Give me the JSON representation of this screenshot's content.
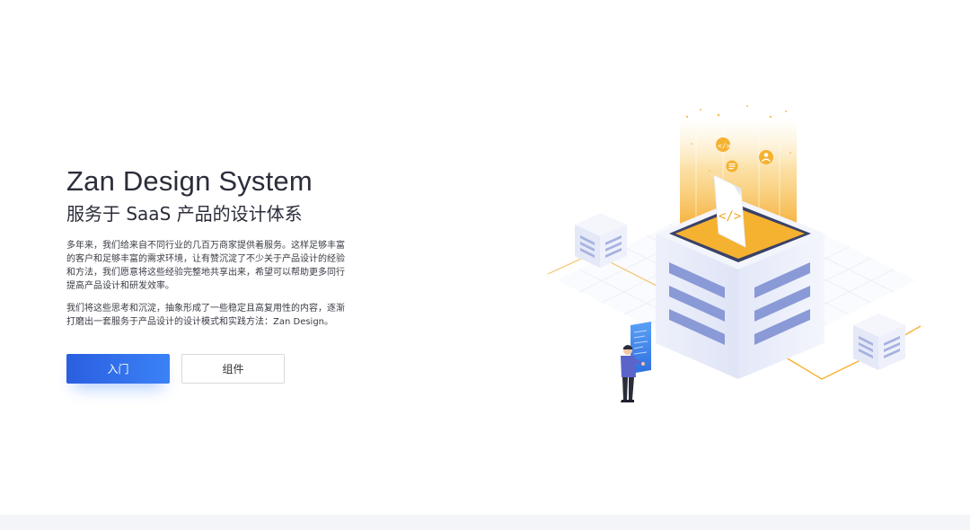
{
  "hero": {
    "title": "Zan Design System",
    "subtitle": "服务于 SaaS 产品的设计体系",
    "paragraphs": [
      "多年来，我们给来自不同行业的几百万商家提供着服务。这样足够丰富的客户和足够丰富的需求环境，让有赞沉淀了不少关于产品设计的经验和方法，我们愿意将这些经验完整地共享出来，希望可以帮助更多同行提高产品设计和研发效率。",
      "我们将这些思考和沉淀，抽象形成了一些稳定且高复用性的内容，逐渐打磨出一套服务于产品设计的设计模式和实践方法：Zan Design。"
    ],
    "buttons": {
      "primary_label": "入门",
      "secondary_label": "组件"
    }
  },
  "colors": {
    "primary": "#3b82f6",
    "accent": "#f5b130",
    "text": "#2b2d3a"
  },
  "illustration": {
    "icons": [
      "code-icon",
      "document-icon",
      "user-icon",
      "code-file-icon"
    ]
  }
}
